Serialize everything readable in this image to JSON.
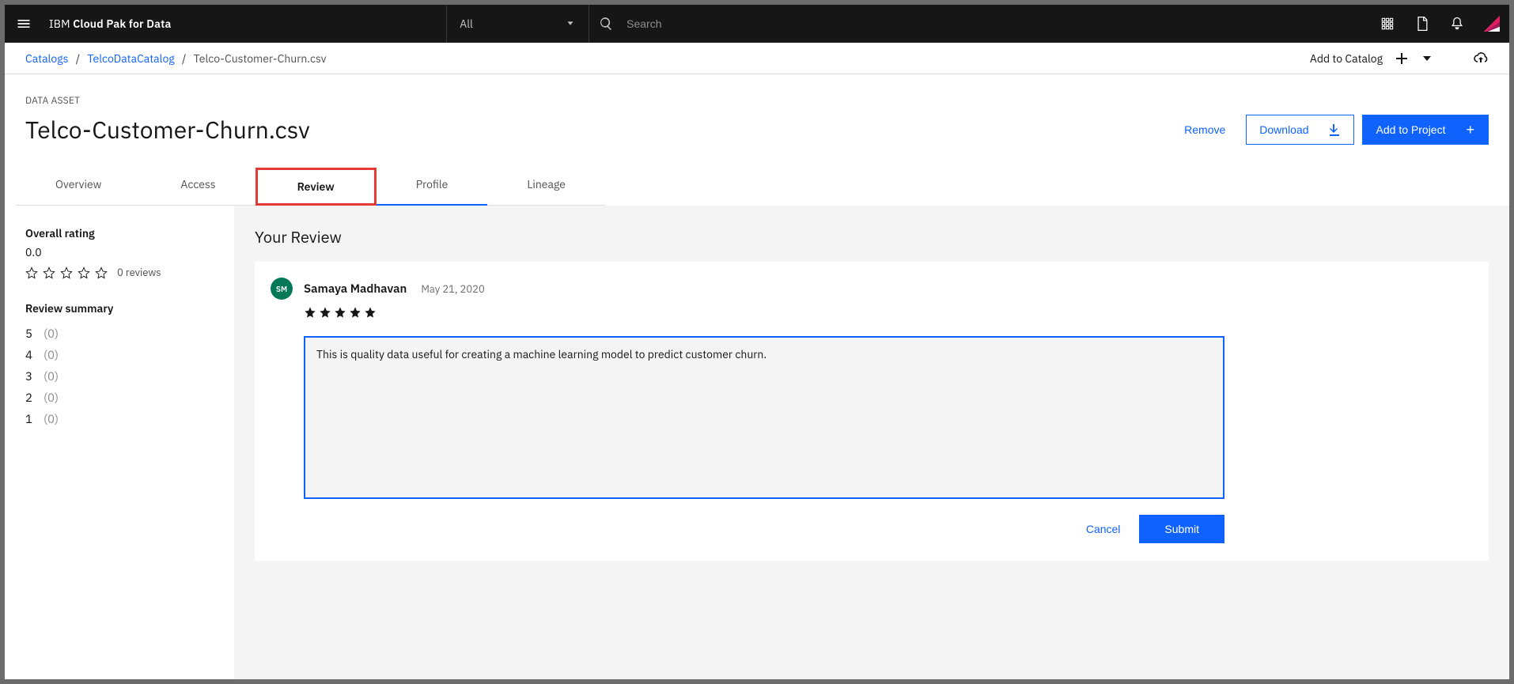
{
  "brand": {
    "prefix": "IBM ",
    "strong": "Cloud Pak for Data"
  },
  "scope_selector": {
    "label": "All"
  },
  "search": {
    "placeholder": "Search"
  },
  "breadcrumb": {
    "items": [
      {
        "label": "Catalogs"
      },
      {
        "label": "TelcoDataCatalog"
      }
    ],
    "current": "Telco-Customer-Churn.csv"
  },
  "subheader_actions": {
    "add_to_catalog": "Add to Catalog"
  },
  "asset": {
    "kicker": "DATA ASSET",
    "title": "Telco-Customer-Churn.csv"
  },
  "actions": {
    "remove": "Remove",
    "download": "Download",
    "add_project": "Add to Project"
  },
  "tabs": {
    "overview": "Overview",
    "access": "Access",
    "review": "Review",
    "profile": "Profile",
    "lineage": "Lineage"
  },
  "sidebar": {
    "overall_label": "Overall rating",
    "overall_value": "0.0",
    "reviews_count": "0 reviews",
    "summary_label": "Review summary",
    "rows": [
      {
        "star": "5",
        "count": "(0)"
      },
      {
        "star": "4",
        "count": "(0)"
      },
      {
        "star": "3",
        "count": "(0)"
      },
      {
        "star": "2",
        "count": "(0)"
      },
      {
        "star": "1",
        "count": "(0)"
      }
    ]
  },
  "review_panel": {
    "heading": "Your Review",
    "avatar_initials": "SM",
    "reviewer": "Samaya Madhavan",
    "date": "May 21, 2020",
    "rating": 5,
    "text": "This is quality data useful for creating a machine learning model to predict customer churn.",
    "cancel": "Cancel",
    "submit": "Submit"
  }
}
